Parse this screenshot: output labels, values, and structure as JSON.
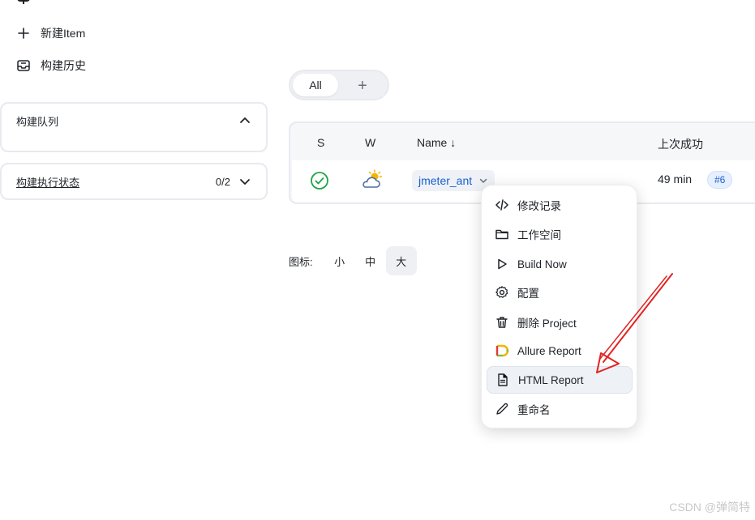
{
  "sidebar": {
    "new_item_label": "新建Item",
    "build_history_label": "构建历史",
    "build_queue": {
      "title": "构建队列"
    },
    "executor_status": {
      "title": "构建执行状态",
      "count": "0/2"
    }
  },
  "view_tabs": {
    "active_label": "All",
    "add_label": "+"
  },
  "table": {
    "headers": {
      "status": "S",
      "weather": "W",
      "name": "Name ↓",
      "last_success": "上次成功"
    },
    "row": {
      "job_name": "jmeter_ant",
      "last_success_time": "49 min",
      "build_number": "#6"
    }
  },
  "icon_size": {
    "label": "图标:",
    "options": [
      "小",
      "中",
      "大"
    ],
    "selected": "大"
  },
  "context_menu": {
    "items": [
      {
        "label": "修改记录",
        "icon": "code-icon"
      },
      {
        "label": "工作空间",
        "icon": "folder-icon"
      },
      {
        "label": "Build Now",
        "icon": "play-icon"
      },
      {
        "label": "配置",
        "icon": "gear-icon"
      },
      {
        "label": "删除 Project",
        "icon": "trash-icon"
      },
      {
        "label": "Allure Report",
        "icon": "allure-icon"
      },
      {
        "label": "HTML Report",
        "icon": "document-icon"
      },
      {
        "label": "重命名",
        "icon": "pencil-icon"
      }
    ],
    "highlighted": "HTML Report"
  },
  "colors": {
    "link": "#1a5fd1",
    "success": "#1ea446",
    "annotation": "#e02424"
  },
  "watermark": "CSDN @弹简特"
}
